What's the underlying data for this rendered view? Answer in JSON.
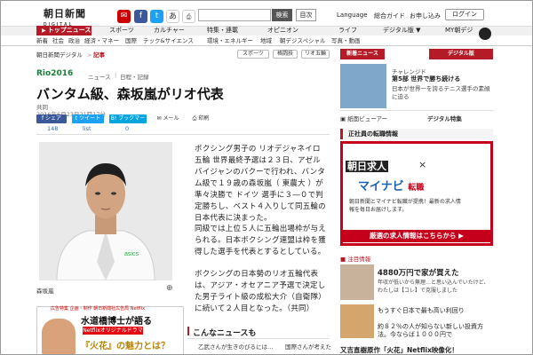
{
  "header": {
    "logo": "朝日新聞",
    "logo_sub": "DIGITAL",
    "search_btn": "検索",
    "index_btn": "目次",
    "language": "Language",
    "sogo": "総合ガイド",
    "moshikomi": "お申し込み",
    "login": "ログイン",
    "font_toggle": "あぁ"
  },
  "nav": {
    "top_news": "トップニュース",
    "items": [
      "スポーツ",
      "カルチャー",
      "特集・連載",
      "オピニオン",
      "ライフ",
      "デジタル版 ▼",
      "MY朝デジ"
    ]
  },
  "subnav": [
    "新着",
    "社会",
    "政治",
    "経済・マネー",
    "国際",
    "テック&サイエンス",
    "環境・エネルギー",
    "地域",
    "朝デジスペシャル",
    "写真・動画"
  ],
  "breadcrumb": {
    "site": "朝日新聞デジタル",
    "sep": ">",
    "current": "記事"
  },
  "tags": [
    "スポーツ",
    "格闘技",
    "リオ五輪"
  ],
  "article": {
    "rio": "Rio2016",
    "rings": "◯◯◯◯◯",
    "keywords": [
      "ニュース",
      "日程・記録"
    ],
    "headline": "バンタム級、森坂嵐がリオ代表",
    "source": "共同",
    "date": "2016年6月23日21時17分",
    "share": [
      "シェア",
      "ツイート",
      "ブックマーク",
      "メール",
      "印刷"
    ],
    "counts": [
      "148",
      "list",
      "0"
    ],
    "caption": "森坂嵐",
    "paragraphs": [
      "ボクシング男子の リオデジャネイロ五輪 世界最終予選は２３日、アゼルバイジャンのバクーで行われ、バンタム級で１９歳の森坂嵐（ 東農大 ）が準々決勝で ドイツ 選手に３―０で判定勝ちし、ベスト４入りして同五輪の日本代表に決まった。",
      "同級では上位５人に五輪出場枠が与えられる。日本ボクシング連盟は枠を獲得した選手を代表とするとしている。",
      "ボクシングの日本勢のリオ五輪代表は、アジア・オセアニア予選で決定した男子ライト級の成松大介（自衛隊）に続いて２人目となった。（共同）"
    ],
    "more_title": "こんなニュースも",
    "more": [
      "乙武さんが生きのびるには…",
      "国際さんが考えた"
    ]
  },
  "ad_left": {
    "top": "広告特集 企画・制作 朝日新聞社広告局 Netflix",
    "h1": "水道橋博士が語る",
    "badge": "Netflixオリジナルドラマ",
    "h2": "『火花』の魅力とは？"
  },
  "right": {
    "tabs": [
      "新着ニュース",
      "デジタル版"
    ],
    "challenge": "チャレンジド",
    "challenge_title": "第5部 世界で勝ち続ける",
    "challenge_desc": "日本が世界一を誇るテニス選手の素顔に迫る",
    "links": [
      "紙面ビューアー",
      "デジタル特集"
    ],
    "job_head": "正社員の転職情報",
    "job_asahi": "朝日求人",
    "job_x": "×",
    "mynavi": "マイナビ",
    "mynavi_sub": "転職",
    "job_text": "朝日新聞とマイナビ転職が提携！最新の求人情報を毎日お届けします。",
    "job_btn": "厳選の求人情報はこちらから ▶",
    "hot_label": "注目情報",
    "hot1_title": "4880万円で家が買えた",
    "hot1_desc": "年収が低いから無理…と思い込んでいたけど、わたしは【コレ】で克服しました",
    "hot2_a": "もうすぐ日本で最も高い利回り",
    "hot2_b": "約８２％の人が知らない新しい投資方法。今ならば１０００円で",
    "bottom": "又吉直樹原作「火花」Netflix映像化！"
  },
  "colors": {
    "brand_red": "#b41b26",
    "mynavi_blue": "#1b5fb3",
    "job_red": "#c4001a",
    "facebook": "#3b5998",
    "twitter": "#1da1f2",
    "hatena": "#00a4de"
  }
}
